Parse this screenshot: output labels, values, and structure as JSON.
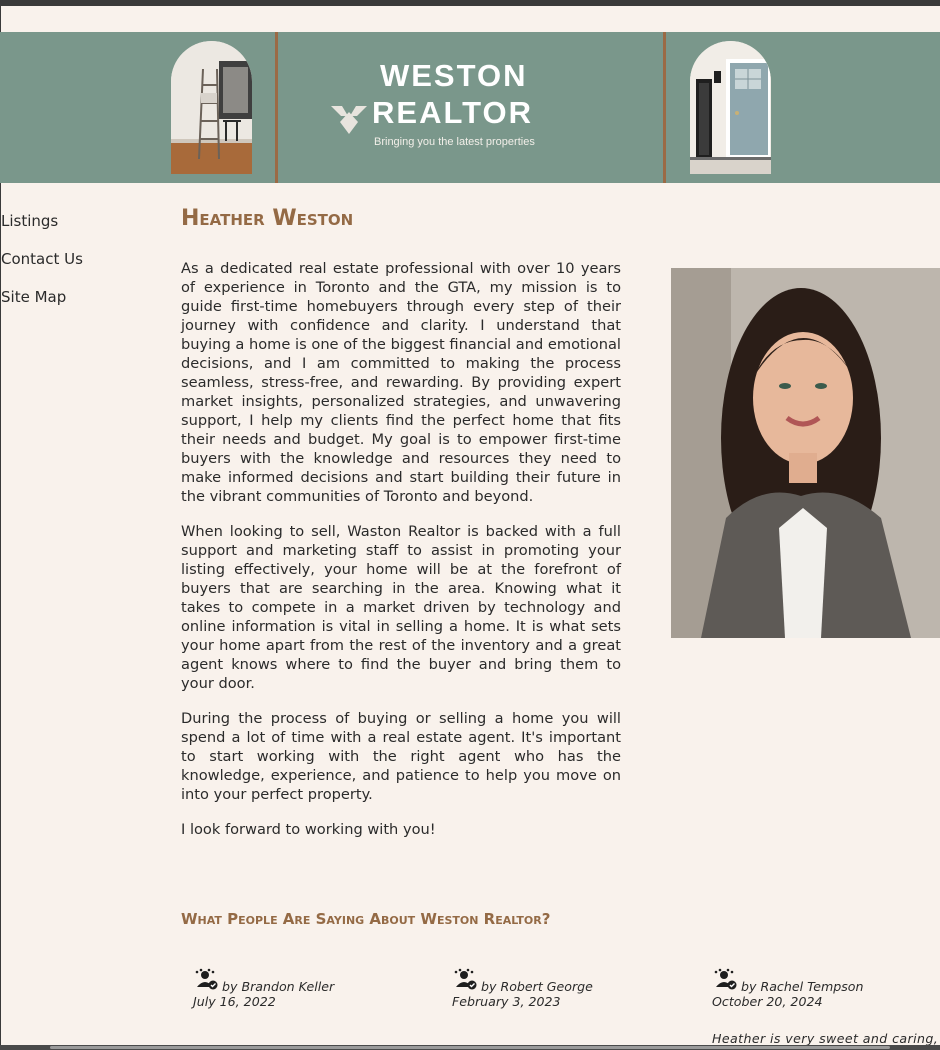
{
  "banner": {
    "logo_line1": "WESTON",
    "logo_line2": "REALTOR",
    "tagline": "Bringing you the latest properties",
    "background": "#7a978b",
    "accent": "#9b6a45"
  },
  "nav": {
    "items": [
      {
        "label": "Listings"
      },
      {
        "label": "Contact Us"
      },
      {
        "label": "Site Map"
      }
    ]
  },
  "main": {
    "title": "Heather Weston",
    "paragraphs": [
      "As a dedicated real estate professional with over 10 years of experience in Toronto and the GTA, my mission is to guide first-time homebuyers through every step of their journey with confidence and clarity. I understand that buying a home is one of the biggest financial and emotional decisions, and I am committed to making the process seamless, stress-free, and rewarding. By providing expert market insights, personalized strategies, and unwavering support, I help my clients find the perfect home that fits their needs and budget. My goal is to empower first-time buyers with the knowledge and resources they need to make informed decisions and start building their future in the vibrant communities of Toronto and beyond.",
      "When looking to sell, Waston Realtor is backed with a full support and marketing staff to assist in promoting your listing effectively, your home will be at the forefront of buyers that are searching in the area. Knowing what it takes to compete in a market driven by technology and online information is vital in selling a home. It is what sets your home apart from the rest of the inventory and a great agent knows where to find the buyer and bring them to your door.",
      "During the process of buying or selling a home you will spend a lot of time with a real estate agent. It's important to start working with the right agent who has the knowledge, experience, and patience to help you move on into your perfect property.",
      "I look forward to working with you!"
    ]
  },
  "testimonials": {
    "heading": "What People Are Saying About Weston Realtor?",
    "items": [
      {
        "by": "by Brandon Keller",
        "date": "July 16, 2022"
      },
      {
        "by": "by Robert George",
        "date": "February 3, 2023"
      },
      {
        "by": "by Rachel Tempson",
        "date": "October 20, 2024"
      }
    ],
    "partial_text": "Heather is very sweet and caring, ar"
  },
  "colors": {
    "page_bg": "#f9f2ec",
    "heading": "#946a45",
    "text": "#2b2b2b"
  }
}
